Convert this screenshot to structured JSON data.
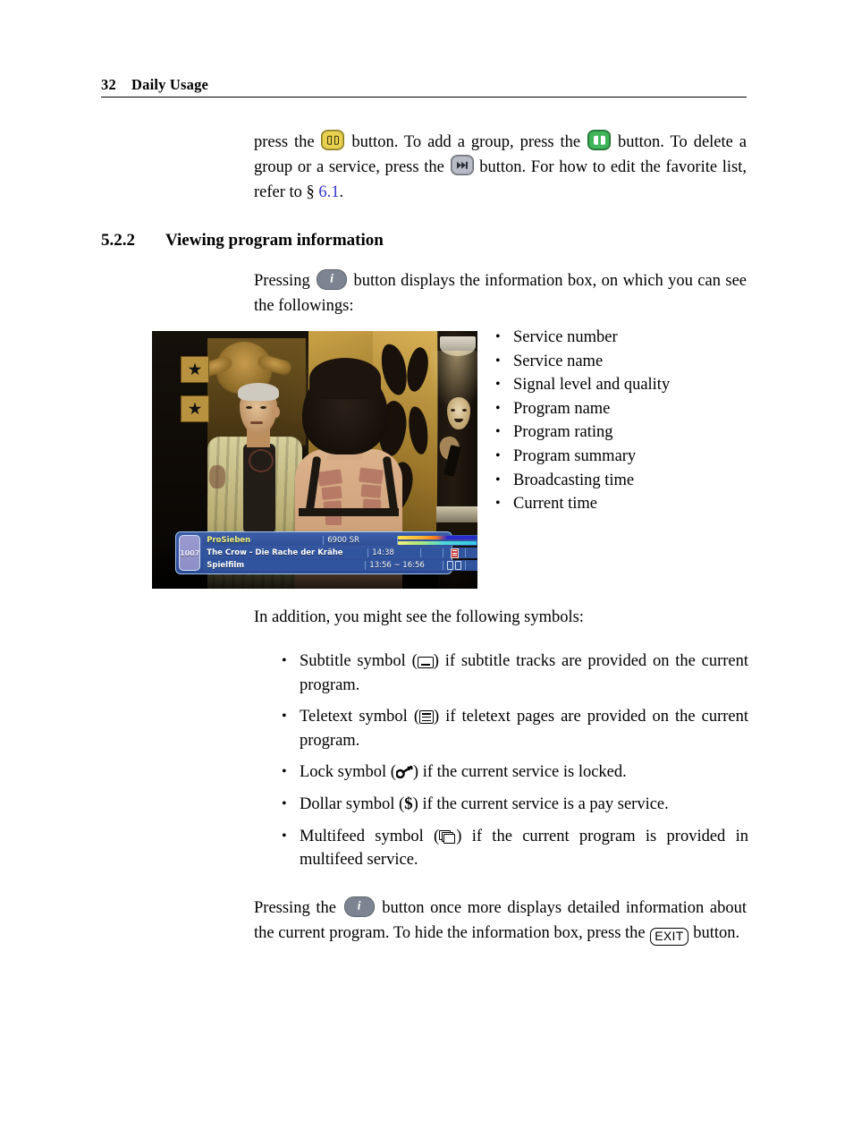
{
  "header": {
    "page_number": "32",
    "title": "Daily Usage"
  },
  "paragraphs": {
    "intro": {
      "seg1": "press the ",
      "seg2": " button.  To add a group, press the ",
      "seg3": " button.  To delete a group or a service, press the ",
      "seg4": " button.   For how to edit the favorite list, refer to § ",
      "xref": "6.1",
      "seg5": "."
    },
    "press_info": {
      "seg1": "Pressing ",
      "seg2": " button displays the information box, on which you can see the followings:"
    },
    "in_addition": "In addition, you might see the following symbols:",
    "final": {
      "seg1": "Pressing the ",
      "seg2": " button once more displays detailed information about the current program.   To hide the information box, press the ",
      "exit_key": "EXIT",
      "seg3": " button."
    }
  },
  "section": {
    "number": "5.2.2",
    "title": "Viewing program information"
  },
  "features_list": [
    "Service number",
    "Service name",
    "Signal level and quality",
    "Program name",
    "Program rating",
    "Program summary",
    "Broadcasting time",
    "Current time"
  ],
  "symbols_list": [
    {
      "icon": "subtitle-icon",
      "before": "Subtitle symbol (",
      "after": ") if subtitle tracks are provided on the current program."
    },
    {
      "icon": "teletext-icon",
      "before": "Teletext symbol (",
      "after": ") if teletext pages are provided on the current program."
    },
    {
      "icon": "lock-key-icon",
      "before": "Lock symbol (",
      "after": ") if the current service is locked."
    },
    {
      "icon": "dollar-icon",
      "before": "Dollar symbol (",
      "glyph": "$",
      "after": ") if the current service is a pay service."
    },
    {
      "icon": "multifeed-icon",
      "before": "Multifeed symbol (",
      "after": ") if the current program is provided in multifeed service."
    }
  ],
  "remote_buttons": {
    "yellow": {
      "name": "yellow-book-button",
      "color": "#e8d14f",
      "icon": "book-icon"
    },
    "green": {
      "name": "green-book-button",
      "color": "#3fb559",
      "icon": "book-icon"
    },
    "gray": {
      "name": "gray-skip-button",
      "color": "#b9bcc6",
      "icon": "skip-icon"
    },
    "info": {
      "name": "info-button",
      "color": "#7b8490",
      "label": "i"
    }
  },
  "tv_screenshot": {
    "name": "tv-screenshot-information-box",
    "osd": {
      "service_number": "1007",
      "service_name": "ProSieben",
      "symbol_rate": "6900 SR",
      "program_name": "The Crow - Die Rache der Krähe",
      "current_time": "14:38",
      "genre": "Spielfilm",
      "broadcast_span": "13:56 ~ 16:56",
      "signal_bar_label": "signal-level-bar",
      "quality_bar_label": "signal-quality-bar",
      "teletext_icon": "teletext-icon",
      "stereo_icon": "dual-audio-icon",
      "accent_border": "#9fc7ef",
      "panel_color": "#31549e",
      "service_name_color": "#f2f27a"
    }
  },
  "colors": {
    "xref_link": "#3333cc",
    "text": "#000000",
    "page_background": "#ffffff"
  }
}
